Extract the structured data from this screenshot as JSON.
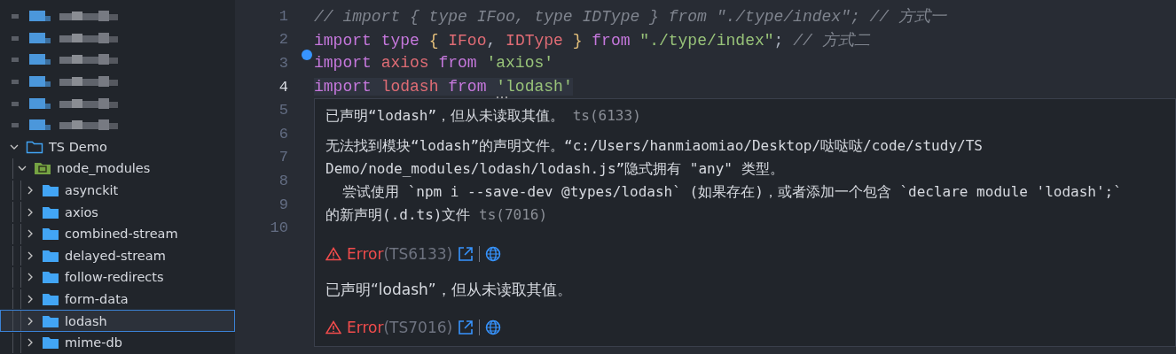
{
  "sidebar": {
    "tree": [
      {
        "kind": "redacted"
      },
      {
        "kind": "redacted"
      },
      {
        "kind": "redacted"
      },
      {
        "kind": "redacted"
      },
      {
        "kind": "redacted"
      },
      {
        "kind": "redacted"
      },
      {
        "kind": "folder",
        "label": "TS Demo",
        "expanded": true,
        "selected": false,
        "children": [
          {
            "kind": "package",
            "label": "node_modules",
            "expanded": true,
            "selected": false,
            "children": [
              {
                "kind": "folder",
                "label": "asynckit",
                "expanded": false,
                "selected": false
              },
              {
                "kind": "folder",
                "label": "axios",
                "expanded": false,
                "selected": false
              },
              {
                "kind": "folder",
                "label": "combined-stream",
                "expanded": false,
                "selected": false
              },
              {
                "kind": "folder",
                "label": "delayed-stream",
                "expanded": false,
                "selected": false
              },
              {
                "kind": "folder",
                "label": "follow-redirects",
                "expanded": false,
                "selected": false
              },
              {
                "kind": "folder",
                "label": "form-data",
                "expanded": false,
                "selected": false
              },
              {
                "kind": "folder",
                "label": "lodash",
                "expanded": false,
                "selected": true
              },
              {
                "kind": "folder",
                "label": "mime-db",
                "expanded": false,
                "selected": false
              }
            ]
          }
        ]
      }
    ]
  },
  "editor": {
    "lines": [
      {
        "number": "1",
        "selected": false,
        "tokens": [
          {
            "kind": "comment",
            "text": "// import { type IFoo, type IDType } from \"./type/index\"; // 方式一"
          }
        ]
      },
      {
        "number": "2",
        "selected": false,
        "tokens": [
          {
            "kind": "keyword",
            "text": "import "
          },
          {
            "kind": "keyword",
            "text": "type "
          },
          {
            "kind": "brace",
            "text": "{ "
          },
          {
            "kind": "name",
            "text": "IFoo"
          },
          {
            "kind": "plain",
            "text": ", "
          },
          {
            "kind": "name",
            "text": "IDType "
          },
          {
            "kind": "brace",
            "text": "} "
          },
          {
            "kind": "keyword",
            "text": "from "
          },
          {
            "kind": "string",
            "text": "\"./type/index\""
          },
          {
            "kind": "plain",
            "text": "; "
          },
          {
            "kind": "comment",
            "text": "// 方式二"
          }
        ]
      },
      {
        "number": "3",
        "selected": false,
        "lightbulb": true,
        "tokens": [
          {
            "kind": "keyword",
            "text": "import "
          },
          {
            "kind": "name",
            "text": "axios "
          },
          {
            "kind": "keyword",
            "text": "from "
          },
          {
            "kind": "string",
            "text": "'axios'"
          }
        ]
      },
      {
        "number": "4",
        "selected": true,
        "tokens": [
          {
            "kind": "keyword",
            "text": "import "
          },
          {
            "kind": "name",
            "text": "lodash "
          },
          {
            "kind": "keyword",
            "text": "from "
          },
          {
            "kind": "string",
            "text": "'lodash'",
            "hint": true
          }
        ]
      },
      {
        "number": "5",
        "selected": false
      },
      {
        "number": "6",
        "selected": false
      },
      {
        "number": "7",
        "selected": false
      },
      {
        "number": "8",
        "selected": false
      },
      {
        "number": "9",
        "selected": false
      },
      {
        "number": "10",
        "selected": false
      }
    ],
    "hover": {
      "messages": [
        {
          "text": "已声明“lodash”，但从未读取其值。",
          "code": "ts(6133)"
        },
        {
          "text": "无法找到模块“lodash”的声明文件。“c:/Users/hanmiaomiao/Desktop/哒哒哒/code/study/TS Demo/node_modules/lodash/lodash.js”隐式拥有 \"any\" 类型。",
          "detail": "尝试使用 `npm i --save-dev @types/lodash` (如果存在)，或者添加一个包含 `declare module 'lodash';` 的新声明(.d.ts)文件",
          "code": "ts(7016)"
        }
      ],
      "problems": [
        {
          "kind": "error",
          "severity": "Error",
          "code": "(TS6133)",
          "message": "已声明“lodash”，但从未读取其值。"
        },
        {
          "kind": "error",
          "severity": "Error",
          "code": "(TS7016)"
        }
      ]
    }
  }
}
